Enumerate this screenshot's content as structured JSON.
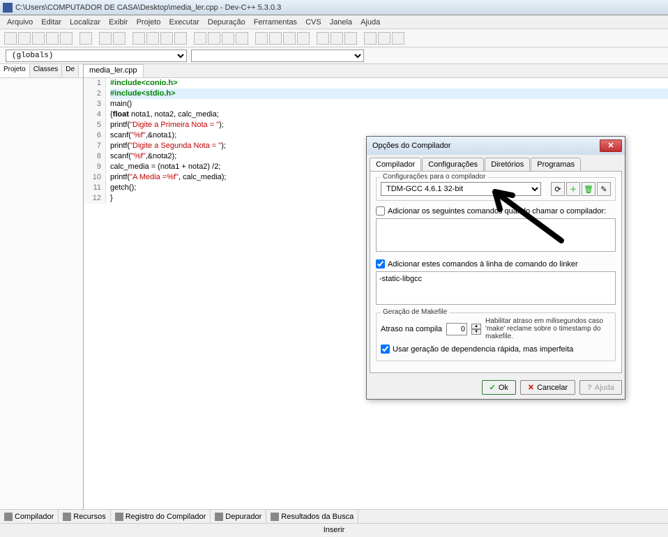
{
  "title": "C:\\Users\\COMPUTADOR DE CASA\\Desktop\\media_ler.cpp - Dev-C++ 5.3.0.3",
  "menus": [
    "Arquivo",
    "Editar",
    "Localizar",
    "Exibir",
    "Projeto",
    "Executar",
    "Depuração",
    "Ferramentas",
    "CVS",
    "Janela",
    "Ajuda"
  ],
  "globals_combo": "(globals)",
  "side_tabs": [
    "Projeto",
    "Classes",
    "De"
  ],
  "file_tab": "media_ler.cpp",
  "code_lines": [
    {
      "n": "1",
      "t": "#include<conio.h>",
      "cls": "kw"
    },
    {
      "n": "2",
      "t": "#include<stdio.h>",
      "cls": "kw hl"
    },
    {
      "n": "3",
      "t": "main()",
      "cls": ""
    },
    {
      "n": "4",
      "t": "{float nota1, nota2, calc_media;",
      "cls": ""
    },
    {
      "n": "5",
      "t": "printf(\"Digite a Primeira Nota = \");",
      "cls": ""
    },
    {
      "n": "6",
      "t": "scanf(\"%f\",&nota1);",
      "cls": ""
    },
    {
      "n": "7",
      "t": "printf(\"Digite a Segunda Nota = \");",
      "cls": ""
    },
    {
      "n": "8",
      "t": "scanf(\"%f\",&nota2);",
      "cls": ""
    },
    {
      "n": "9",
      "t": "calc_media = (nota1 + nota2) /2;",
      "cls": ""
    },
    {
      "n": "10",
      "t": "printf(\"A Media =%f\", calc_media);",
      "cls": ""
    },
    {
      "n": "11",
      "t": "getch();",
      "cls": ""
    },
    {
      "n": "12",
      "t": "}",
      "cls": ""
    }
  ],
  "bottom_tabs": [
    "Compilador",
    "Recursos",
    "Registro do Compilador",
    "Depurador",
    "Resultados da Busca"
  ],
  "status": "Inserir",
  "dialog": {
    "title": "Opções do Compilador",
    "tabs": [
      "Compilador",
      "Configurações",
      "Diretórios",
      "Programas"
    ],
    "compiler_config_label": "Configurações para o compilador",
    "compiler_selected": "TDM-GCC 4.6.1 32-bit",
    "chk_call": "Adicionar os seguintes comandos quando chamar o compilador:",
    "chk_linker": "Adicionar estes comandos à linha de comando do linker",
    "linker_text": "-static-libgcc",
    "makefile_label": "Geração de Makefile",
    "delay_label": "Atraso na compila",
    "delay_value": "0",
    "delay_hint": "Habilitar atraso em milisegundos caso 'make' reclame sobre o timestamp do makefile.",
    "chk_fastdep": "Usar geração de dependencia rápida, mas imperfeita",
    "ok": "Ok",
    "cancel": "Cancelar",
    "help": "Ajuda"
  }
}
